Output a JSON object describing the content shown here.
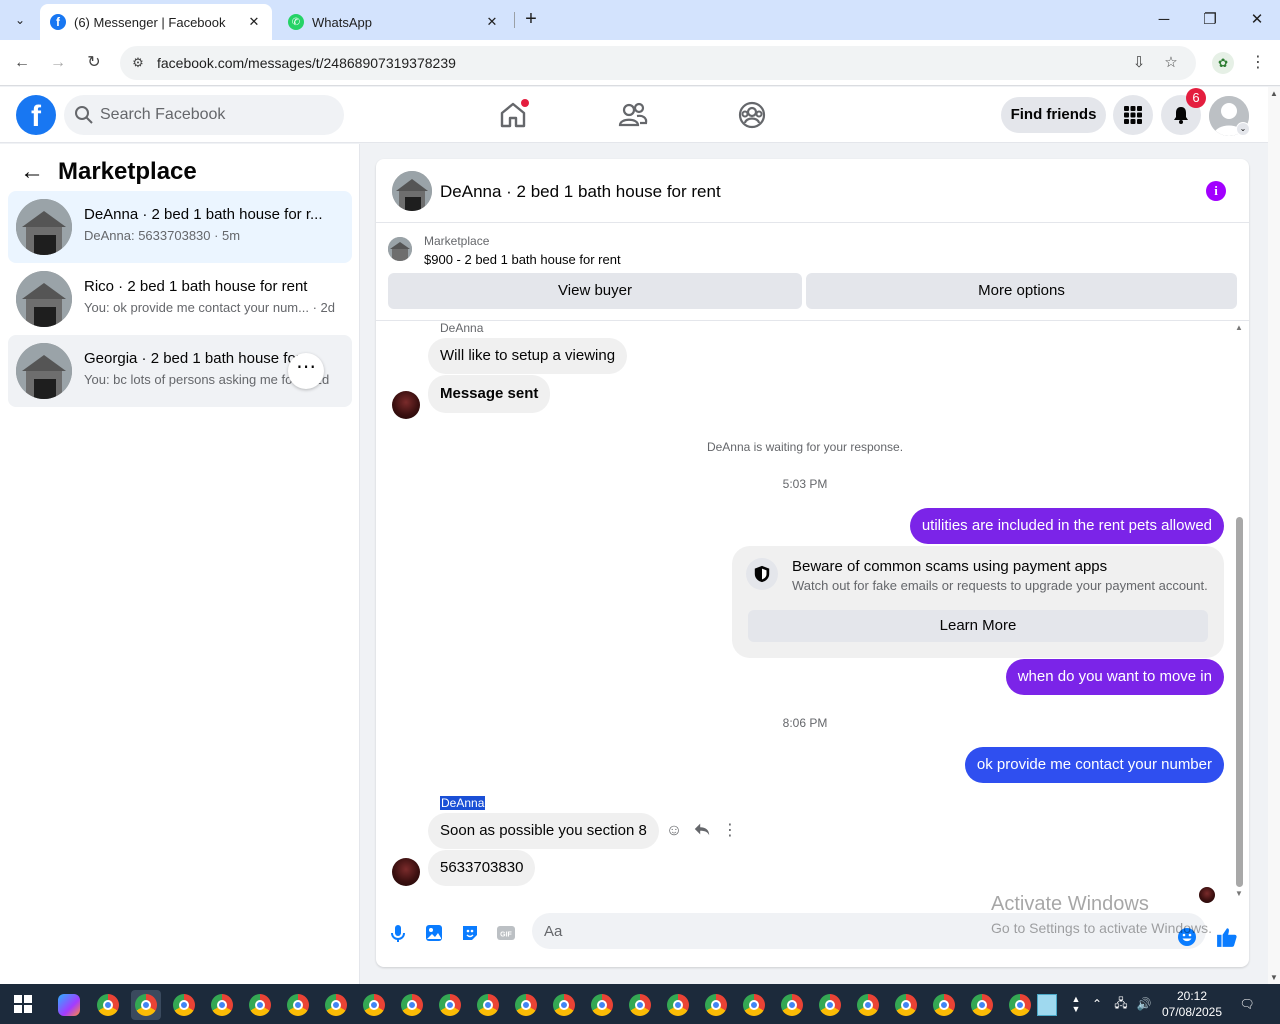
{
  "browser": {
    "tabs": [
      {
        "title": "(6) Messenger | Facebook",
        "active": true
      },
      {
        "title": "WhatsApp",
        "active": false
      }
    ],
    "url": "facebook.com/messages/t/24868907319378239"
  },
  "fb": {
    "search_placeholder": "Search Facebook",
    "find_friends": "Find friends",
    "notification_count": "6"
  },
  "sidebar": {
    "title": "Marketplace",
    "conversations": [
      {
        "name": "DeAnna · 2 bed 1 bath house for r...",
        "preview": "DeAnna: 5633703830 · 5m"
      },
      {
        "name": "Rico · 2 bed 1 bath house for rent",
        "preview": "You: ok provide me contact your num... · 2d"
      },
      {
        "name": "Georgia · 2 bed 1 bath house for r...",
        "preview": "You: bc lots of persons asking me for ... 2d"
      }
    ]
  },
  "chat": {
    "title": "DeAnna · 2 bed 1 bath house for rent",
    "marketplace_label": "Marketplace",
    "listing": "$900 - 2 bed 1 bath house for rent",
    "view_buyer": "View buyer",
    "more_options": "More options",
    "messages": {
      "sender1": "DeAnna",
      "in1": "Will like to setup a viewing",
      "in2": "Message sent",
      "waiting": "DeAnna is waiting for your response.",
      "time1": "5:03 PM",
      "out1": "utilities are included in the rent pets allowed",
      "scam_title": "Beware of common scams using payment apps",
      "scam_desc": "Watch out for fake emails or requests to upgrade your payment account.",
      "learn_more": "Learn More",
      "out2": "when do you want to move in",
      "time2": "8:06 PM",
      "out3": "ok provide me contact your number",
      "sender2": "DeAnna",
      "in3": "Soon as possible you section 8",
      "in4": "5633703830"
    },
    "composer_placeholder": "Aa"
  },
  "watermark": {
    "line1": "Activate Windows",
    "line2": "Go to Settings to activate Windows."
  },
  "taskbar": {
    "time": "20:12",
    "date": "07/08/2025"
  },
  "colors": {
    "fb_blue": "#1877f2",
    "outgoing_purple": "#7b24e8",
    "outgoing_blue": "#2f4ff0",
    "badge_red": "#e41e3f",
    "info_purple": "#a200ff"
  }
}
